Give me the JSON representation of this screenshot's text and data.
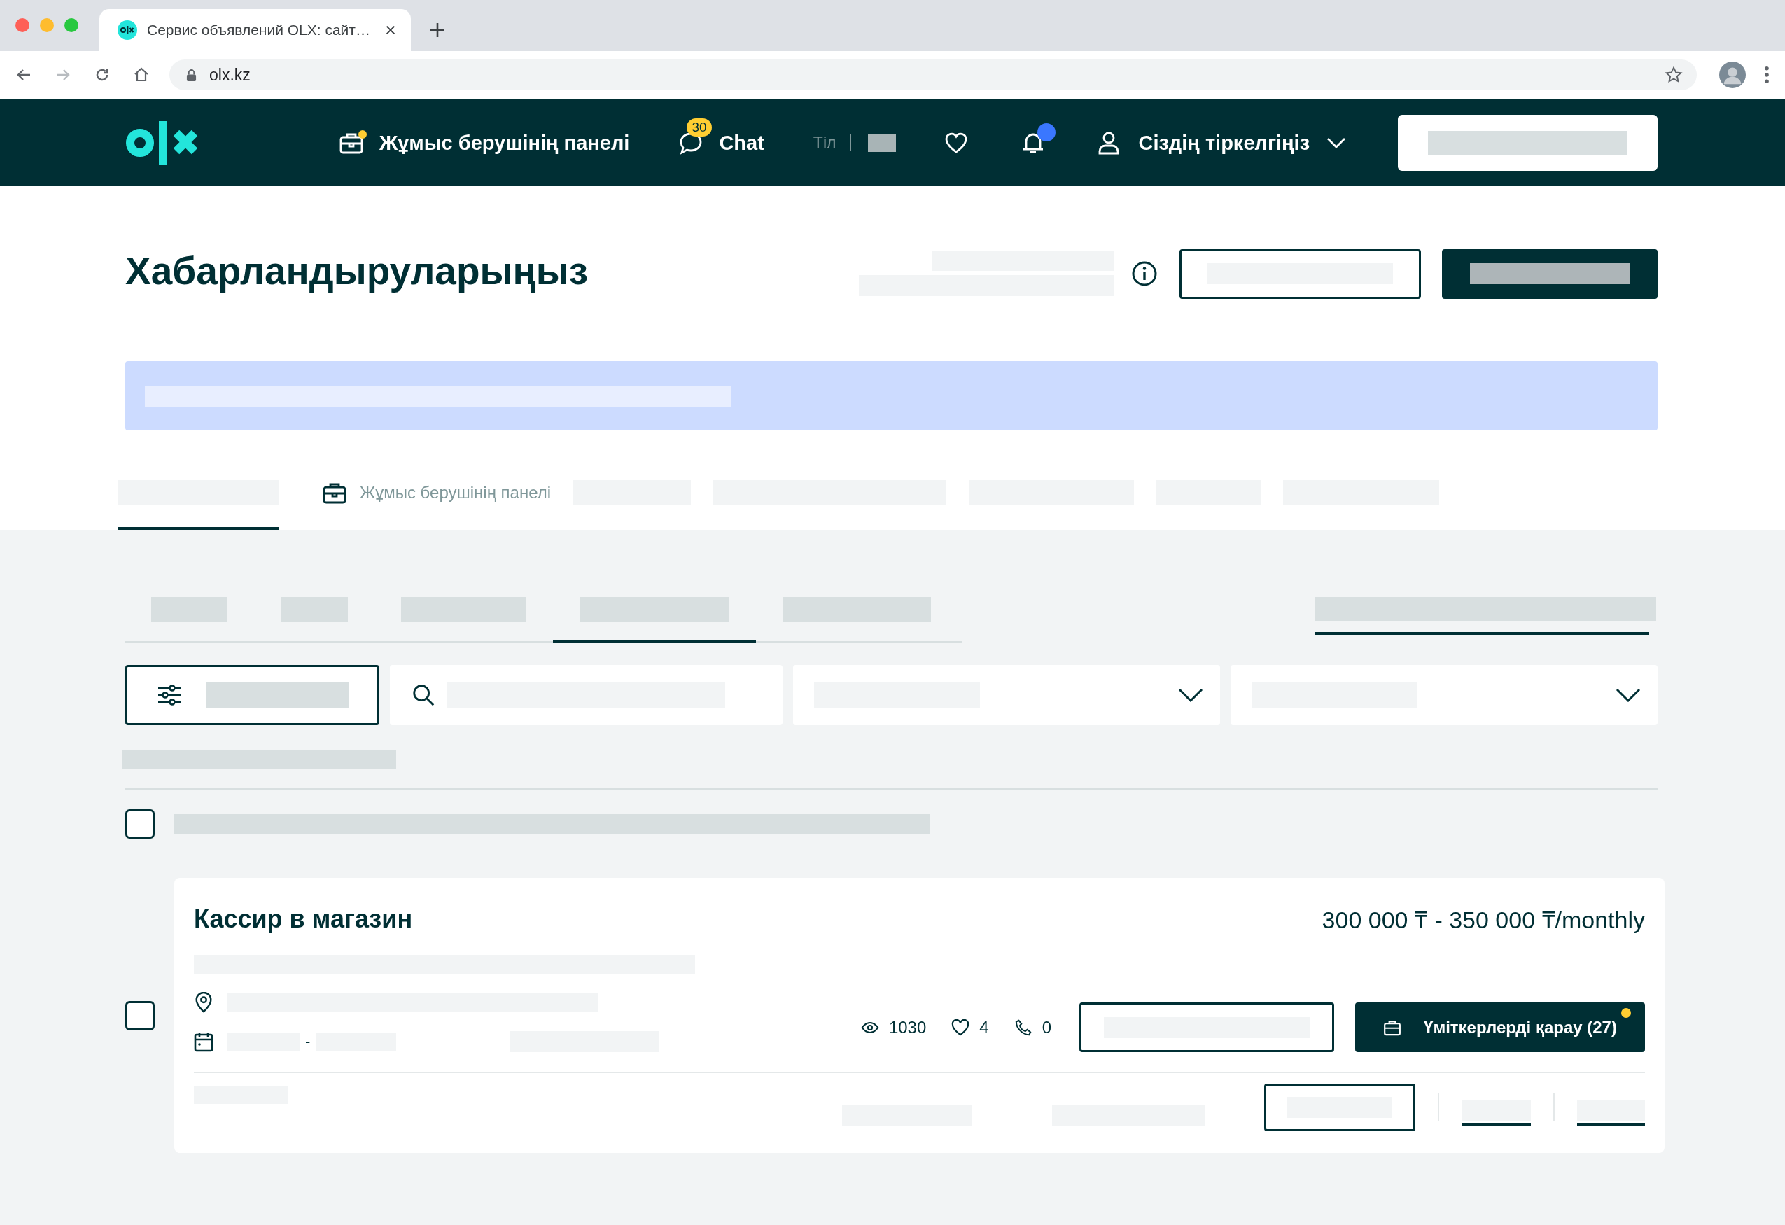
{
  "browser": {
    "tab_title": "Сервис объявлений OLX: сайт…",
    "url": "olx.kz"
  },
  "header": {
    "employer_panel": {
      "label": "Жұмыс берушінің панелі",
      "has_dot": true
    },
    "chat": {
      "label": "Chat",
      "badge": "30"
    },
    "language": {
      "label": "Тіл"
    },
    "notifications": {
      "has_dot": true
    },
    "account": {
      "label": "Сіздің тіркелгіңіз"
    }
  },
  "page": {
    "title": "Хабарландыруларыңыз"
  },
  "tabs": [
    {
      "kind": "redacted",
      "selected": true
    },
    {
      "kind": "labeled",
      "label": "Жұмыс берушінің панелі",
      "selected": false
    },
    {
      "kind": "redacted",
      "selected": false
    },
    {
      "kind": "redacted",
      "selected": false
    },
    {
      "kind": "redacted",
      "selected": false
    },
    {
      "kind": "redacted",
      "selected": false
    },
    {
      "kind": "redacted",
      "selected": false
    }
  ],
  "status_tabs": [
    {
      "selected": false
    },
    {
      "selected": false
    },
    {
      "selected": false
    },
    {
      "selected": true
    },
    {
      "selected": false
    }
  ],
  "select_all": {
    "checked": false
  },
  "listing": {
    "checked": false,
    "title": "Кассир в магазин",
    "salary": "300 000 ₸ - 350 000 ₸/monthly",
    "date_separator": "-",
    "views": "1030",
    "likes": "4",
    "calls": "0",
    "applicants_button": {
      "label": "Үміткерлерді қарау (27)",
      "has_dot": true
    }
  }
}
